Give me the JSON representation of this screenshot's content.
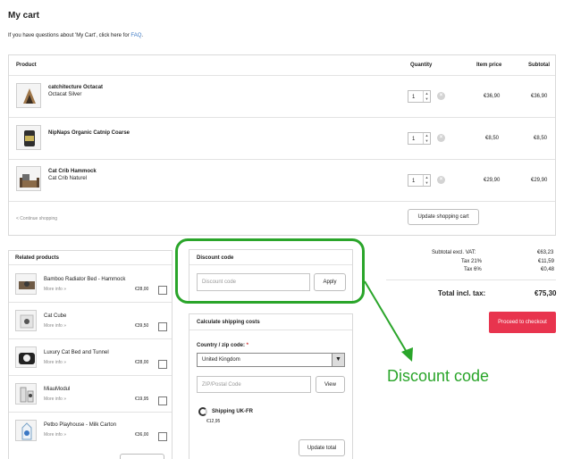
{
  "page": {
    "title": "My cart",
    "faq_prefix": "If you have questions about 'My Cart', click here for ",
    "faq_link": "FAQ",
    "faq_suffix": "."
  },
  "cart": {
    "headers": {
      "product": "Product",
      "quantity": "Quantity",
      "item_price": "Item price",
      "subtotal": "Subtotal"
    },
    "items": [
      {
        "name": "catchitecture Octacat",
        "variant": "Octacat Silver",
        "qty": "1",
        "price": "€36,90",
        "subtotal": "€36,90"
      },
      {
        "name": "NipNaps Organic Catnip Coarse",
        "variant": "",
        "qty": "1",
        "price": "€8,50",
        "subtotal": "€8,50"
      },
      {
        "name": "Cat Crib Hammock",
        "variant": "Cat Crib Naturel",
        "qty": "1",
        "price": "€29,90",
        "subtotal": "€29,90"
      }
    ],
    "continue_shopping": "< Continue shopping",
    "update_button": "Update shopping cart",
    "remove_icon": "×"
  },
  "related": {
    "title": "Related products",
    "more_info": "More info »",
    "items": [
      {
        "name": "Bamboo Radiator Bed - Hammock",
        "price": "€28,00"
      },
      {
        "name": "Cat Cube",
        "price": "€39,50"
      },
      {
        "name": "Luxury Cat Bed and Tunnel",
        "price": "€28,00"
      },
      {
        "name": "MiauModul",
        "price": "€19,95"
      },
      {
        "name": "Petbo Playhouse - Milk Carton",
        "price": "€36,00"
      }
    ]
  },
  "discount": {
    "title": "Discount code",
    "placeholder": "Discount code",
    "apply": "Apply",
    "annotation": "Discount code",
    "highlight_color": "#2aa52a"
  },
  "shipping": {
    "title": "Calculate shipping costs",
    "country_label": "Country / zip code:",
    "required_mark": "*",
    "country_value": "United Kingdom",
    "zip_placeholder": "ZIP/Postal Code",
    "view": "View",
    "method": "Shipping UK-FR",
    "method_price": "€12,95",
    "update_total": "Update total"
  },
  "totals": {
    "subtotal_label": "Subtotal excl. VAT:",
    "subtotal_value": "€63,23",
    "tax21_label": "Tax 21%",
    "tax21_value": "€11,59",
    "tax6_label": "Tax 6%",
    "tax6_value": "€0,48",
    "total_label": "Total incl. tax:",
    "total_value": "€75,30",
    "checkout": "Proceed to checkout",
    "checkout_color": "#e8344e"
  }
}
